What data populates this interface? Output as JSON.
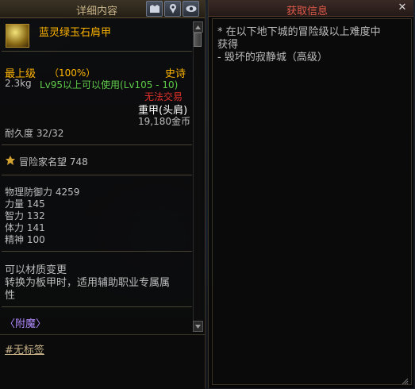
{
  "left_panel": {
    "title": "详细内容",
    "header_icons": [
      "compare-icon",
      "pin-icon",
      "eye-icon"
    ],
    "item": {
      "name": "蓝灵绿玉石肩甲",
      "grade": "最上级",
      "grade_percent": "（100%）",
      "rarity": "史诗",
      "weight": "2.3kg",
      "level_req": "Lv95以上可以使用(Lv105 - 10)",
      "trade": "无法交易",
      "slot": "重甲(头肩)",
      "price": "19,180金币",
      "durability": "耐久度 32/32",
      "reputation": "冒险家名望 748",
      "stats": [
        "物理防御力 4259",
        "力量 145",
        "智力 132",
        "体力 141",
        "精神 100"
      ],
      "desc_line1": "可以材质变更",
      "desc_line2": "转换为板甲时，适用辅助职业专属属",
      "desc_line3": "性",
      "enchant": "〈附魔〉"
    },
    "tag_link": "#无标签"
  },
  "right_panel": {
    "title": "获取信息",
    "close_label": "✕",
    "source_line1": "* 在以下地下城的冒险级以上难度中",
    "source_line2": "获得",
    "source_line3": "- 毁坏的寂静城（高级）"
  },
  "colors": {
    "epic": "#ffb400",
    "green": "#5ecb4a",
    "untradeable": "#e0302a",
    "header_red": "#e05a4a"
  }
}
